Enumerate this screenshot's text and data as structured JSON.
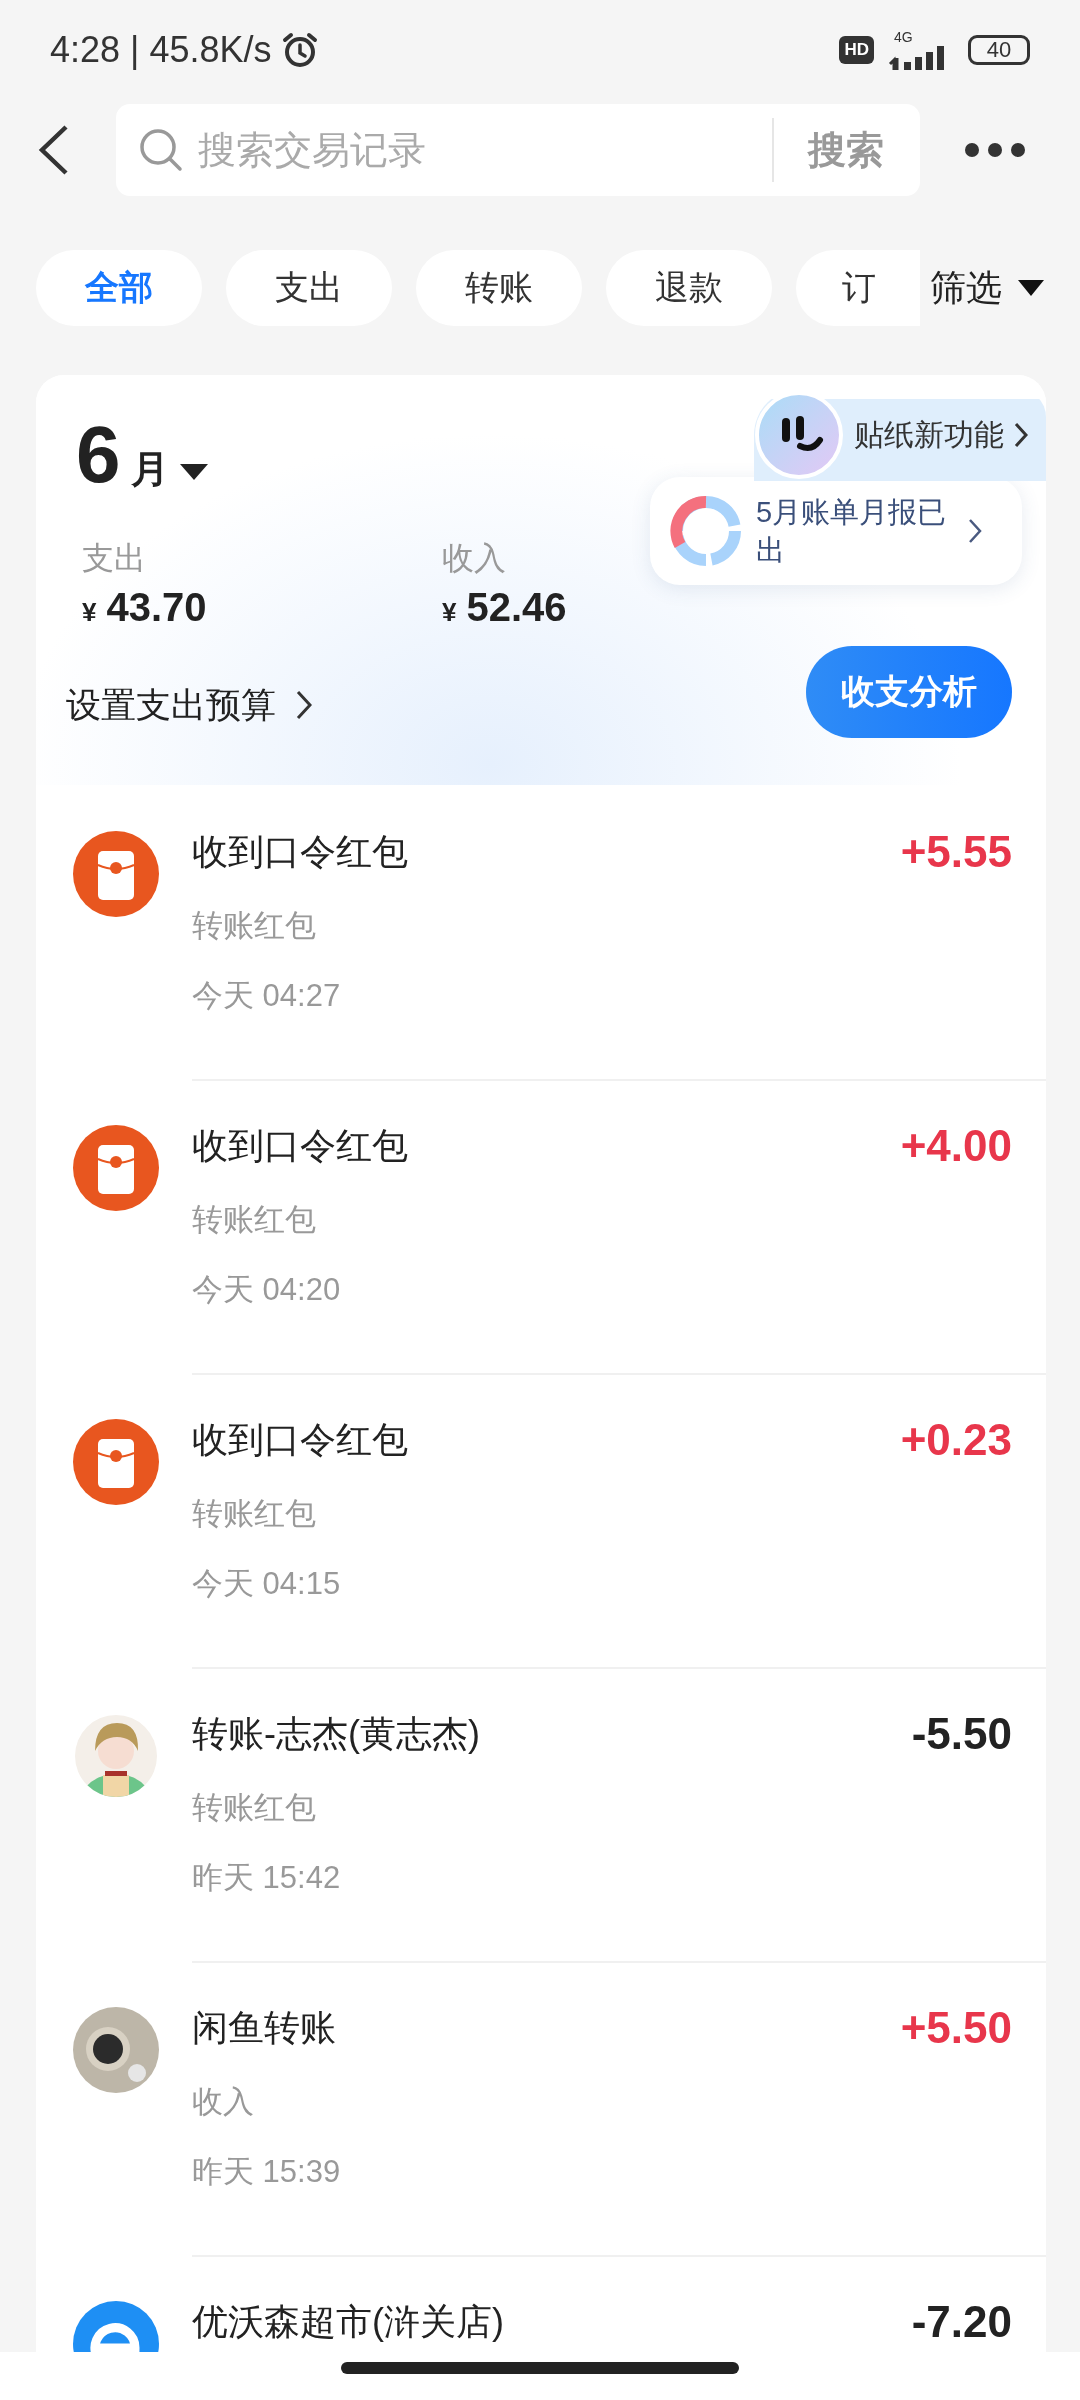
{
  "status_bar": {
    "time": "4:28 | 45.8K/s",
    "hd_badge": "HD",
    "network": "4G",
    "battery": "40"
  },
  "search": {
    "placeholder": "搜索交易记录",
    "button": "搜索"
  },
  "filters": [
    {
      "label": "全部",
      "selected": true
    },
    {
      "label": "支出",
      "selected": false
    },
    {
      "label": "转账",
      "selected": false
    },
    {
      "label": "退款",
      "selected": false
    },
    {
      "label": "订",
      "selected": false
    }
  ],
  "filter_button": "筛选",
  "summary": {
    "month": "6",
    "month_unit": "月",
    "sticker_link": "贴纸新功能",
    "expense": {
      "label": "支出",
      "currency": "¥",
      "amount": "43.70"
    },
    "income": {
      "label": "收入",
      "currency": "¥",
      "amount": "52.46"
    },
    "report": "5月账单月报已出",
    "budget_link": "设置支出预算",
    "analysis_button": "收支分析"
  },
  "transactions": [
    {
      "kind": "red_packet",
      "title": "收到口令红包",
      "subtitle": "转账红包",
      "time": "今天 04:27",
      "amount": "+5.55",
      "income": true
    },
    {
      "kind": "red_packet",
      "title": "收到口令红包",
      "subtitle": "转账红包",
      "time": "今天 04:20",
      "amount": "+4.00",
      "income": true
    },
    {
      "kind": "red_packet",
      "title": "收到口令红包",
      "subtitle": "转账红包",
      "time": "今天 04:15",
      "amount": "+0.23",
      "income": true
    },
    {
      "kind": "person_photo",
      "title": "转账-志杰(黄志杰)",
      "subtitle": "转账红包",
      "time": "昨天 15:42",
      "amount": "-5.50",
      "income": false
    },
    {
      "kind": "round_photo",
      "title": "闲鱼转账",
      "subtitle": "收入",
      "time": "昨天 15:39",
      "amount": "+5.50",
      "income": true
    },
    {
      "kind": "store_logo",
      "title": "优沃森超市(浒关店)",
      "amount": "-7.20",
      "income": false
    }
  ]
}
